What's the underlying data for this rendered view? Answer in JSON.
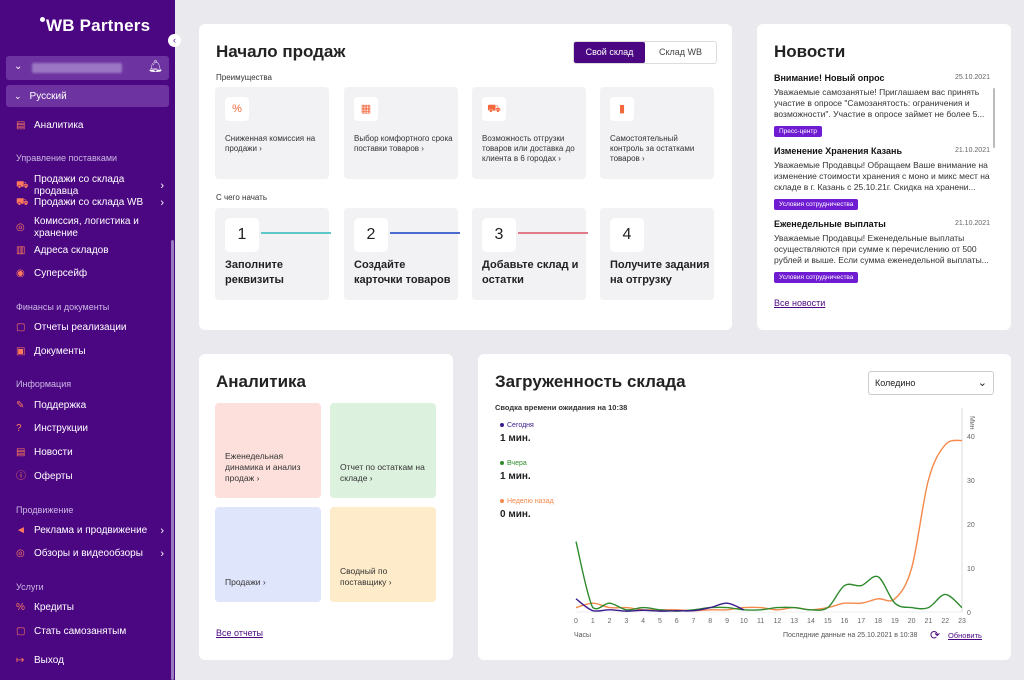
{
  "sidebar": {
    "logo": "WB Partners",
    "language": "Русский",
    "items": {
      "analytics": "Аналитика",
      "section_supply": "Управление поставками",
      "sales_seller": "Продажи со склада продавца",
      "sales_wb": "Продажи со склада WB",
      "commission": "Комиссия, логистика и хранение",
      "warehouses": "Адреса складов",
      "supersafe": "Суперсейф",
      "section_finance": "Финансы и документы",
      "reports": "Отчеты реализации",
      "documents": "Документы",
      "section_info": "Информация",
      "support": "Поддержка",
      "instructions": "Инструкции",
      "news": "Новости",
      "offers": "Оферты",
      "section_promo": "Продвижение",
      "ads": "Реклама и продвижение",
      "reviews": "Обзоры и видеообзоры",
      "section_services": "Услуги",
      "credits": "Кредиты",
      "selfemployed": "Стать самозанятым",
      "logout": "Выход"
    }
  },
  "start": {
    "title": "Начало продаж",
    "toggle": {
      "own": "Свой склад",
      "wb": "Склад WB"
    },
    "advantages_label": "Преимущества",
    "advantages": [
      {
        "icon": "percent-icon",
        "glyph": "%",
        "text": "Сниженная комиссия на продажи ›"
      },
      {
        "icon": "calendar-icon",
        "glyph": "▦",
        "text": "Выбор комфортного срока поставки товаров ›"
      },
      {
        "icon": "truck-icon",
        "glyph": "⛟",
        "text": "Возможность отгрузки товаров или доставка до клиента в 6 городах ›"
      },
      {
        "icon": "bar-chart-icon",
        "glyph": "▮",
        "text": "Самостоятельный контроль за остатками товаров ›"
      }
    ],
    "steps_label": "С чего начать",
    "steps": [
      {
        "num": "1",
        "text": "Заполните реквизиты"
      },
      {
        "num": "2",
        "text": "Создайте карточки товаров"
      },
      {
        "num": "3",
        "text": "Добавьте склад и остатки"
      },
      {
        "num": "4",
        "text": "Получите задания на отгрузку"
      }
    ]
  },
  "news": {
    "title": "Новости",
    "items": [
      {
        "title": "Внимание! Новый опрос",
        "date": "25.10.2021",
        "body": "Уважаемые самозанятые!  Приглашаем вас принять участие в опросе \"Самозанятость: ограничения и возможности\".  Участие в опросе займет не более 5...",
        "badge": "Пресс-центр"
      },
      {
        "title": "Изменение Хранения Казань",
        "date": "21.10.2021",
        "body": "Уважаемые Продавцы! Обращаем Ваше внимание на изменение стоимости хранения с моно и микс мест на складе в г. Казань с 25.10.21г. Скидка на хранени...",
        "badge": "Условия сотрудничества"
      },
      {
        "title": "Еженедельные выплаты",
        "date": "21.10.2021",
        "body": "Уважаемые Продавцы! Еженедельные выплаты осуществляются при сумме к перечислению от 500 рублей и выше. Если сумма еженедельной выплаты...",
        "badge": "Условия сотрудничества"
      }
    ],
    "all_link": "Все новости"
  },
  "analytics": {
    "title": "Аналитика",
    "tiles": [
      {
        "text": "Еженедельная динамика и анализ продаж ›",
        "color": "#fde0dc"
      },
      {
        "text": "Отчет по остаткам на складе ›",
        "color": "#dcf1de"
      },
      {
        "text": "Продажи ›",
        "color": "#dfe5fb"
      },
      {
        "text": "Сводный по поставщику ›",
        "color": "#fdebc9"
      }
    ],
    "all_link": "Все отчеты"
  },
  "load": {
    "title": "Загруженность склада",
    "select_value": "Коледино",
    "summary": "Сводка времени ожидания на 10:38",
    "legend": [
      {
        "name": "Сегодня",
        "value": "1 мин.",
        "color": "#3a1b8c"
      },
      {
        "name": "Вчера",
        "value": "1 мин.",
        "color": "#2e8b2e"
      },
      {
        "name": "Неделю назад",
        "value": "0 мин.",
        "color": "#f5884b"
      }
    ],
    "hours_label": "Часы",
    "last_data": "Последние данные на 25.10.2021 в 10:38",
    "refresh": "Обновить"
  },
  "chart_data": {
    "type": "line",
    "x": [
      0,
      1,
      2,
      3,
      4,
      5,
      6,
      7,
      8,
      9,
      10,
      11,
      12,
      13,
      14,
      15,
      16,
      17,
      18,
      19,
      20,
      21,
      22,
      23
    ],
    "ylabel": "Мин",
    "ylim": [
      0,
      45
    ],
    "yticks": [
      0,
      10,
      20,
      30,
      40
    ],
    "series": [
      {
        "name": "Сегодня",
        "color": "#3a1b8c",
        "values": [
          3,
          0.3,
          0.5,
          0.2,
          0.4,
          0.2,
          0.3,
          0.3,
          1,
          2,
          0.5
        ]
      },
      {
        "name": "Вчера",
        "color": "#2e8b2e",
        "values": [
          16,
          1,
          2,
          0.5,
          1,
          0.5,
          0.2,
          0.5,
          1,
          1,
          0.5,
          0.5,
          1,
          1,
          0.5,
          1,
          6,
          6,
          8,
          2,
          1,
          1,
          4,
          1
        ]
      },
      {
        "name": "Неделю назад",
        "color": "#f5884b",
        "values": [
          1,
          2,
          1,
          1,
          0.5,
          0.5,
          0.5,
          0.3,
          0.5,
          0.5,
          1,
          1,
          0.5,
          1,
          0.5,
          1,
          2,
          2,
          3,
          3,
          10,
          30,
          38,
          39
        ]
      }
    ]
  }
}
